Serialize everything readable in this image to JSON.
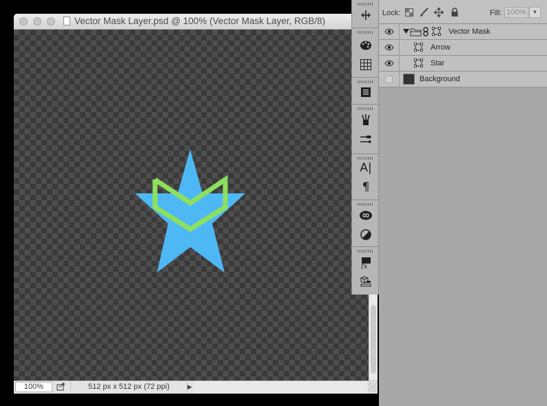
{
  "document": {
    "title": "Vector Mask Layer.psd @ 100% (Vector Mask Layer, RGB/8)",
    "zoom": "100%",
    "doc_size": "512 px x 512 px (72 ppi)",
    "colors": {
      "star": "#4eb8f4",
      "arrow": "#8ee05c"
    },
    "icons": [
      "close-icon",
      "minimize-icon",
      "zoom-icon",
      "document-icon",
      "export-icon",
      "triangle-right-icon"
    ]
  },
  "tool_strip": {
    "icons": [
      "measure-icon",
      "color-palette-icon",
      "swatches-icon",
      "properties-icon",
      "brushes-icon",
      "brush-presets-icon",
      "character-icon",
      "paragraph-icon",
      "libraries-icon",
      "adjustments-icon",
      "styles-icon",
      "layer-comps-icon"
    ],
    "character_glyph": "A|",
    "paragraph_glyph": "¶",
    "styles_glyph": "fx"
  },
  "layers_panel": {
    "lock_label": "Lock:",
    "fill_label": "Fill:",
    "fill_value": "100%",
    "layers": [
      {
        "name": "Vector Mask",
        "visible": true,
        "type": "group"
      },
      {
        "name": "Arrow",
        "visible": true,
        "type": "shape"
      },
      {
        "name": "Star",
        "visible": true,
        "type": "shape"
      },
      {
        "name": "Background",
        "visible": false,
        "type": "pixel"
      }
    ]
  }
}
